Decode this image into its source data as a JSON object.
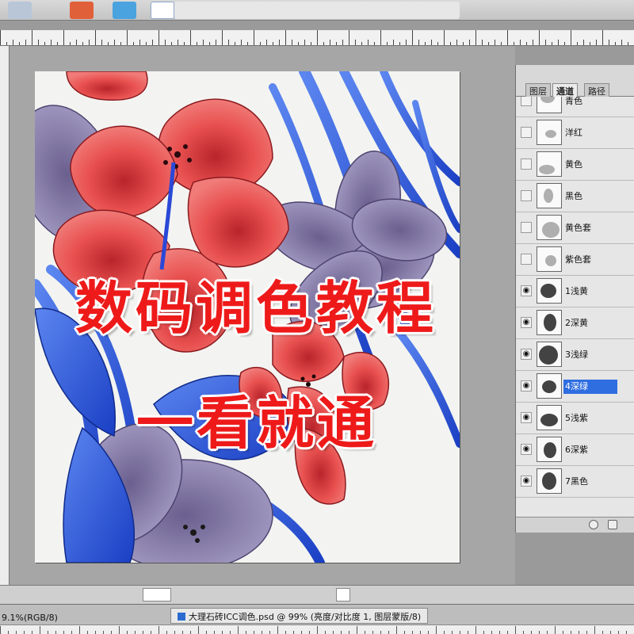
{
  "document": {
    "tab_title": "大理石砖ICC调色.psd @ 99% (亮度/对比度 1, 图层蒙版/8)",
    "status_zoom": "9.1%(RGB/8)"
  },
  "overlay": {
    "line1": "数码调色教程",
    "line2": "一看就通"
  },
  "panel": {
    "tabs": [
      "图层",
      "通道",
      "路径"
    ],
    "active_tab": "通道",
    "channels": [
      {
        "label": "青色",
        "visible": false,
        "selected": false
      },
      {
        "label": "洋红",
        "visible": false,
        "selected": false
      },
      {
        "label": "黄色",
        "visible": false,
        "selected": false
      },
      {
        "label": "黑色",
        "visible": false,
        "selected": false
      },
      {
        "label": "黄色套",
        "visible": false,
        "selected": false
      },
      {
        "label": "紫色套",
        "visible": false,
        "selected": false
      },
      {
        "label": "1浅黄",
        "visible": true,
        "selected": false
      },
      {
        "label": "2深黄",
        "visible": true,
        "selected": false
      },
      {
        "label": "3浅绿",
        "visible": true,
        "selected": false
      },
      {
        "label": "4深绿",
        "visible": true,
        "selected": true
      },
      {
        "label": "5浅紫",
        "visible": true,
        "selected": false
      },
      {
        "label": "6深紫",
        "visible": true,
        "selected": false
      },
      {
        "label": "7黑色",
        "visible": true,
        "selected": false
      }
    ]
  },
  "icons": {
    "eye": "eye-icon",
    "new_channel": "new-channel-icon",
    "load_selection": "load-selection-icon"
  },
  "colors": {
    "selection": "#2f6ee0",
    "overlay_text": "#ee1a1a",
    "hibiscus": "#e8504f",
    "leaf_blue": "#1f4fd6",
    "lavender": "#8f86b0"
  }
}
